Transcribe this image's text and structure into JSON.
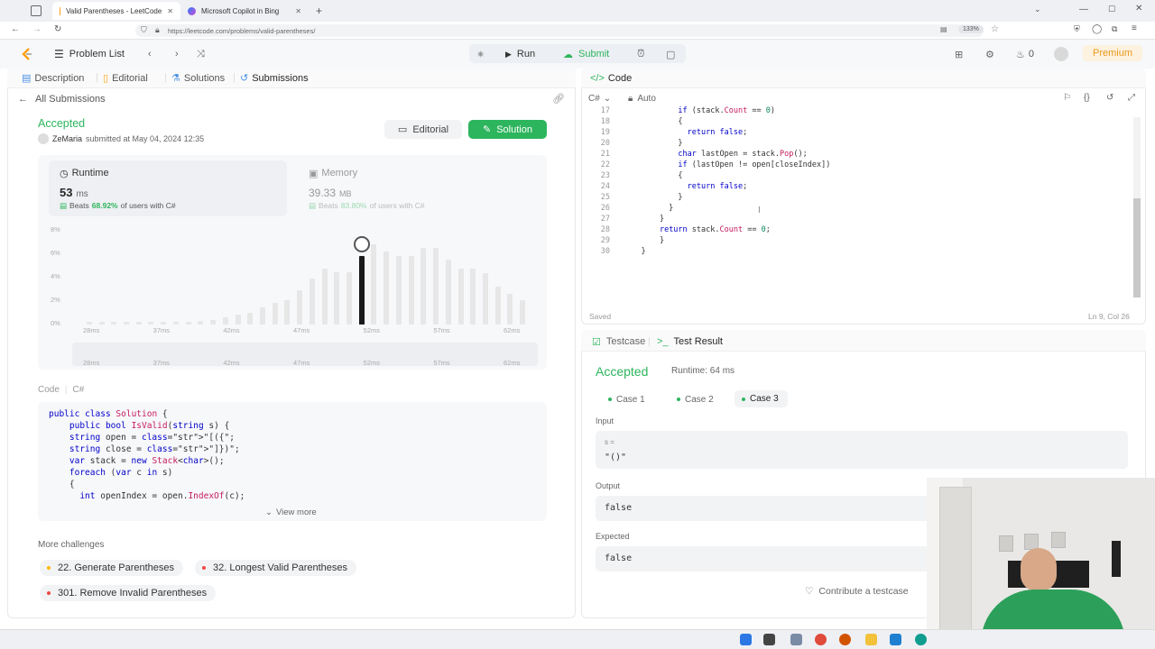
{
  "browser": {
    "tabs": [
      {
        "title": "Valid Parentheses - LeetCode",
        "active": true
      },
      {
        "title": "Microsoft Copilot in Bing",
        "active": false
      }
    ],
    "url": "https://leetcode.com/problems/valid-parentheses/",
    "zoom": "133%"
  },
  "header": {
    "problem_list": "Problem List",
    "run": "Run",
    "submit": "Submit",
    "streak": "0",
    "premium": "Premium"
  },
  "left_tabs": [
    "Description",
    "Editorial",
    "Solutions",
    "Submissions"
  ],
  "submission": {
    "back_label": "All Submissions",
    "status": "Accepted",
    "user": "ZeMaria",
    "submitted_text": "submitted at May 04, 2024 12:35",
    "editorial_btn": "Editorial",
    "solution_btn": "Solution",
    "runtime": {
      "label": "Runtime",
      "value": "53",
      "unit": "ms",
      "beats_label": "Beats",
      "beats": "68.92%",
      "suffix": "of users with C#"
    },
    "memory": {
      "label": "Memory",
      "value": "39.33",
      "unit": "MB",
      "beats_label": "Beats",
      "beats": "83.80%",
      "suffix": "of users with C#"
    }
  },
  "chart_data": {
    "type": "bar",
    "yticks": [
      "8%",
      "6%",
      "4%",
      "2%",
      "0%"
    ],
    "xticks": [
      "28ms",
      "37ms",
      "42ms",
      "47ms",
      "52ms",
      "57ms",
      "62ms"
    ],
    "values": [
      0.2,
      0.2,
      0.2,
      0.2,
      0.2,
      0.2,
      0.2,
      0.2,
      0.2,
      0.3,
      0.4,
      0.6,
      0.8,
      1.0,
      1.4,
      1.8,
      2.0,
      2.8,
      3.8,
      4.6,
      4.3,
      4.3,
      5.6,
      6.6,
      6.0,
      5.6,
      5.6,
      6.3,
      6.3,
      5.3,
      4.6,
      4.6,
      4.2,
      3.1,
      2.5,
      2.0
    ],
    "highlight_index": 22,
    "ylim": [
      0,
      8
    ]
  },
  "code_section": {
    "label": "Code",
    "lang": "C#",
    "lines": [
      "public class Solution {",
      "    public bool IsValid(string s) {",
      "    string open = \"[({\";",
      "    string close = \"]})\";",
      "    var stack = new Stack<char>();",
      "    foreach (var c in s)",
      "    {",
      "      int openIndex = open.IndexOf(c);"
    ],
    "view_more": "View more"
  },
  "more_challenges": {
    "title": "More challenges",
    "items": [
      {
        "label": "22. Generate Parentheses",
        "color": "#ffb800"
      },
      {
        "label": "32. Longest Valid Parentheses",
        "color": "#ef4743"
      },
      {
        "label": "301. Remove Invalid Parentheses",
        "color": "#ef4743"
      }
    ]
  },
  "editor": {
    "title": "Code",
    "lang": "C#",
    "mode": "Auto",
    "start_line": 17,
    "lines": [
      "            if (stack.Count == 0)",
      "            {",
      "              return false;",
      "            }",
      "            char lastOpen = stack.Pop();",
      "            if (lastOpen != open[closeIndex])",
      "            {",
      "              return false;",
      "            }",
      "          }",
      "        }",
      "        return stack.Count == 0;",
      "        }",
      "    }"
    ],
    "saved": "Saved",
    "cursor": "Ln 9, Col 26"
  },
  "test": {
    "tabs": [
      "Testcase",
      "Test Result"
    ],
    "status": "Accepted",
    "runtime": "Runtime: 64 ms",
    "cases": [
      "Case 1",
      "Case 2",
      "Case 3"
    ],
    "input_label": "Input",
    "input_var": "s =",
    "input_value": "\"()\"",
    "output_label": "Output",
    "output_value": "false",
    "expected_label": "Expected",
    "expected_value": "false",
    "contribute": "Contribute a testcase"
  }
}
